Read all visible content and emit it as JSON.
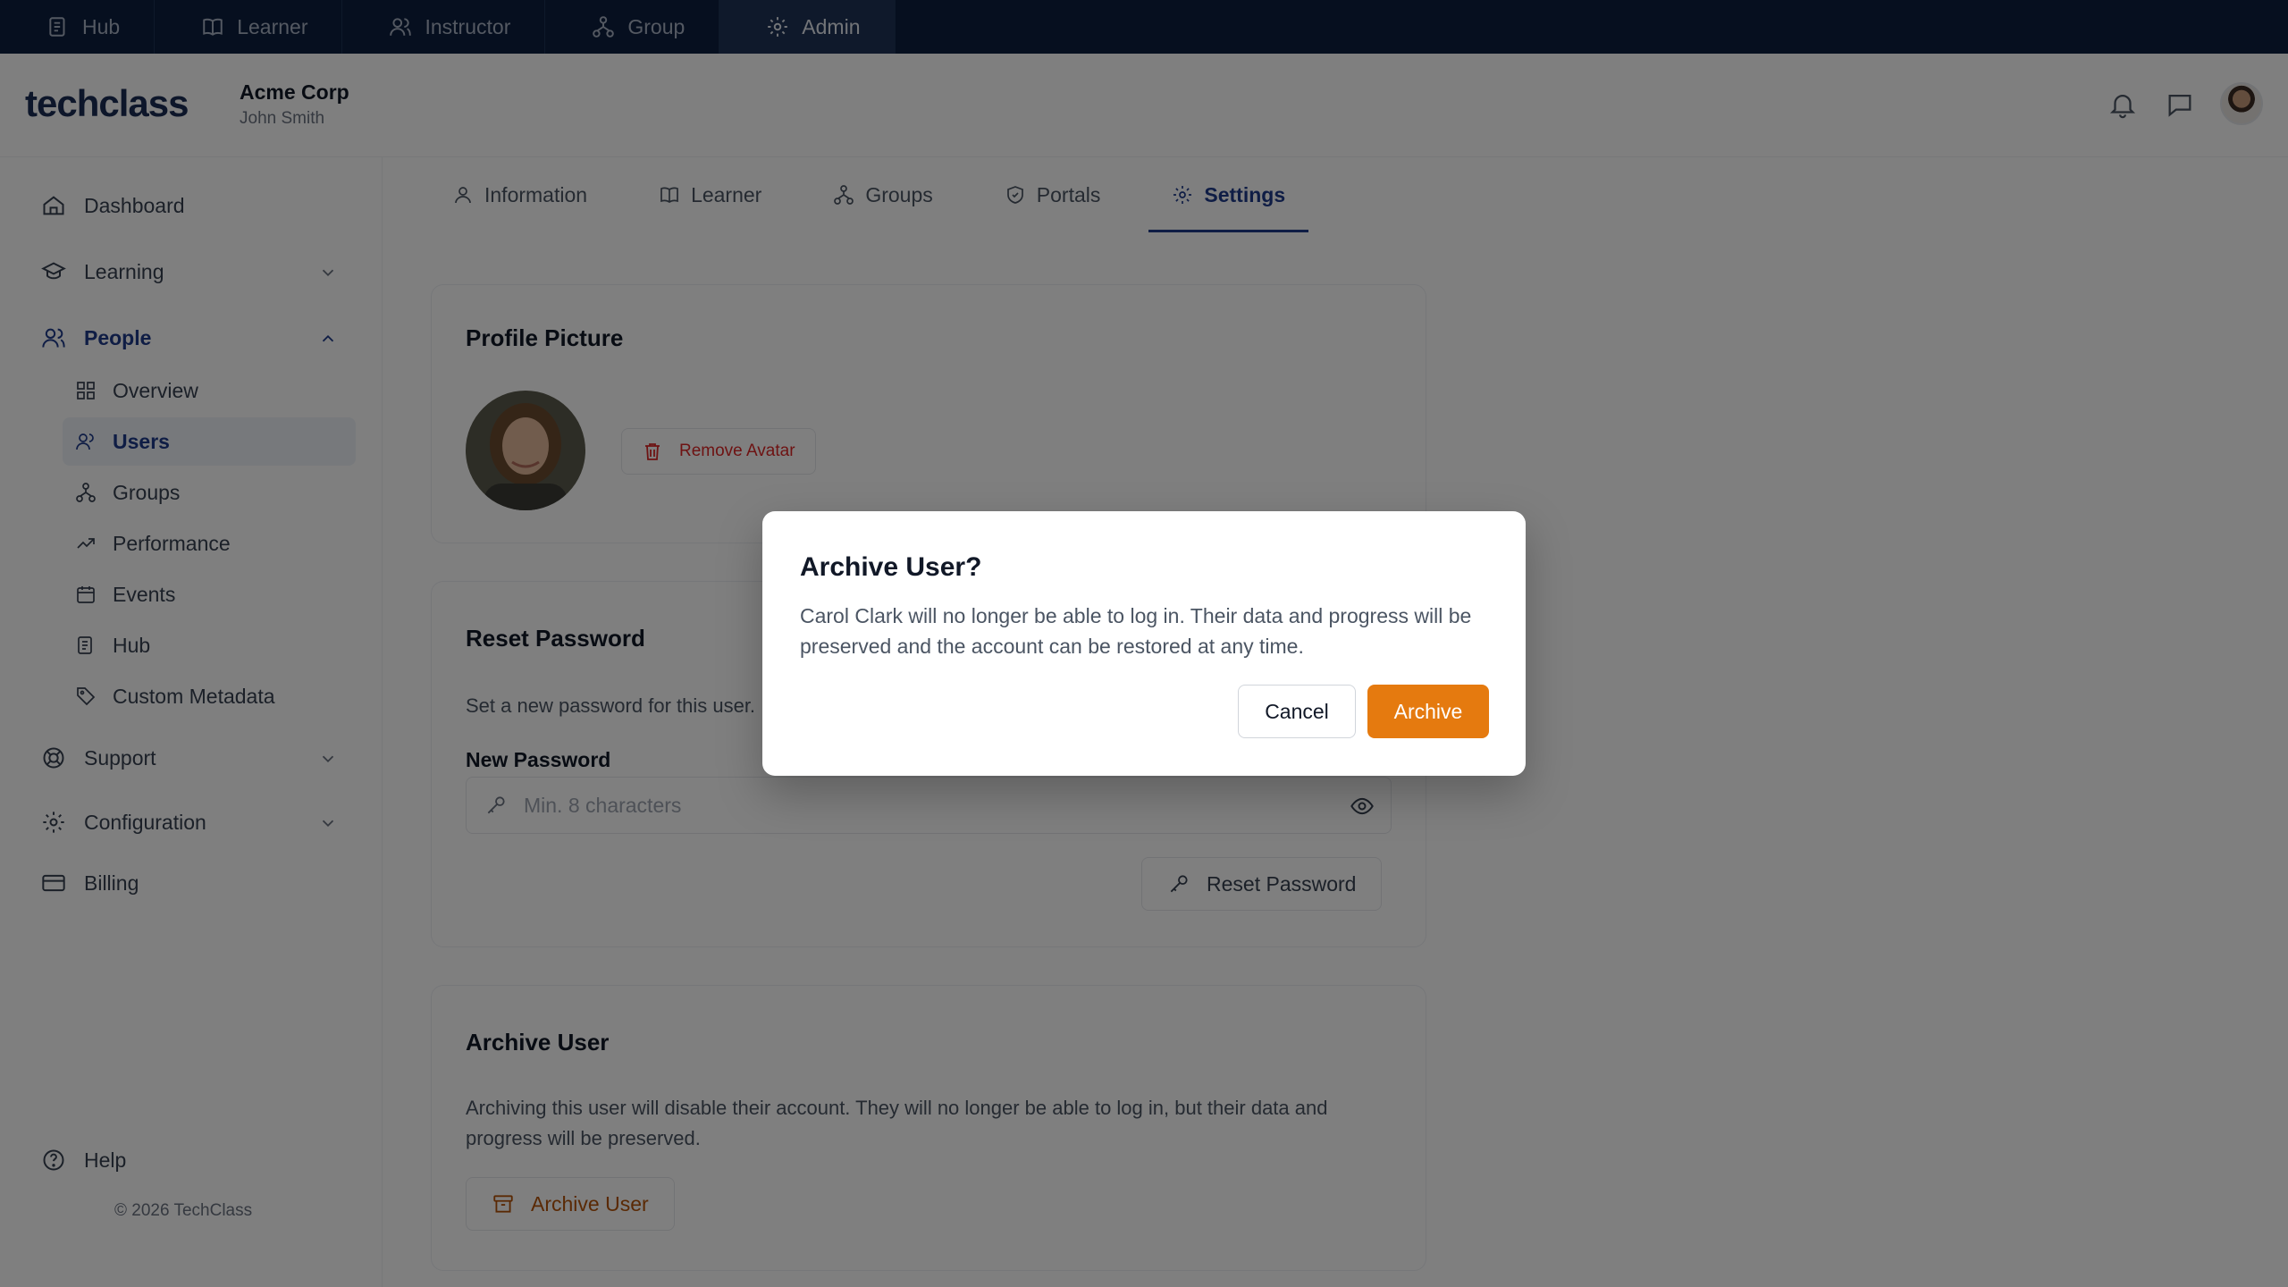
{
  "topnav": {
    "items": [
      {
        "label": "Hub",
        "icon": "hub-icon"
      },
      {
        "label": "Learner",
        "icon": "book-icon"
      },
      {
        "label": "Instructor",
        "icon": "instructor-icon"
      },
      {
        "label": "Group",
        "icon": "group-icon"
      },
      {
        "label": "Admin",
        "icon": "gear-icon"
      }
    ],
    "active": "Admin"
  },
  "header": {
    "logo_text": "techclass",
    "org_name": "Acme Corp",
    "user_name": "John Smith"
  },
  "sidebar": {
    "dashboard": "Dashboard",
    "learning": "Learning",
    "people": "People",
    "people_items": [
      "Overview",
      "Users",
      "Groups",
      "Performance",
      "Events",
      "Hub",
      "Custom Metadata"
    ],
    "active_item": "Users",
    "support": "Support",
    "configuration": "Configuration",
    "billing": "Billing",
    "help": "Help",
    "copyright": "© 2026 TechClass"
  },
  "tabs": {
    "items": [
      "Information",
      "Learner",
      "Groups",
      "Portals",
      "Settings"
    ],
    "active": "Settings"
  },
  "profile_card": {
    "title": "Profile Picture",
    "remove_label": "Remove Avatar"
  },
  "password_card": {
    "title": "Reset Password",
    "description": "Set a new password for this user.",
    "field_label": "New Password",
    "placeholder": "Min. 8 characters",
    "button_label": "Reset Password"
  },
  "archive_card": {
    "title": "Archive User",
    "description": "Archiving this user will disable their account. They will no longer be able to log in, but their data and progress will be preserved.",
    "button_label": "Archive User"
  },
  "modal": {
    "title": "Archive User?",
    "message": "Carol Clark will no longer be able to log in. Their data and progress will be preserved and the account can be restored at any time.",
    "cancel_label": "Cancel",
    "confirm_label": "Archive"
  },
  "colors": {
    "topbar": "#0c1e3e",
    "accent_navy": "#1e3a8a",
    "archive_orange": "#e57a0f",
    "danger_red": "#dc2626"
  }
}
